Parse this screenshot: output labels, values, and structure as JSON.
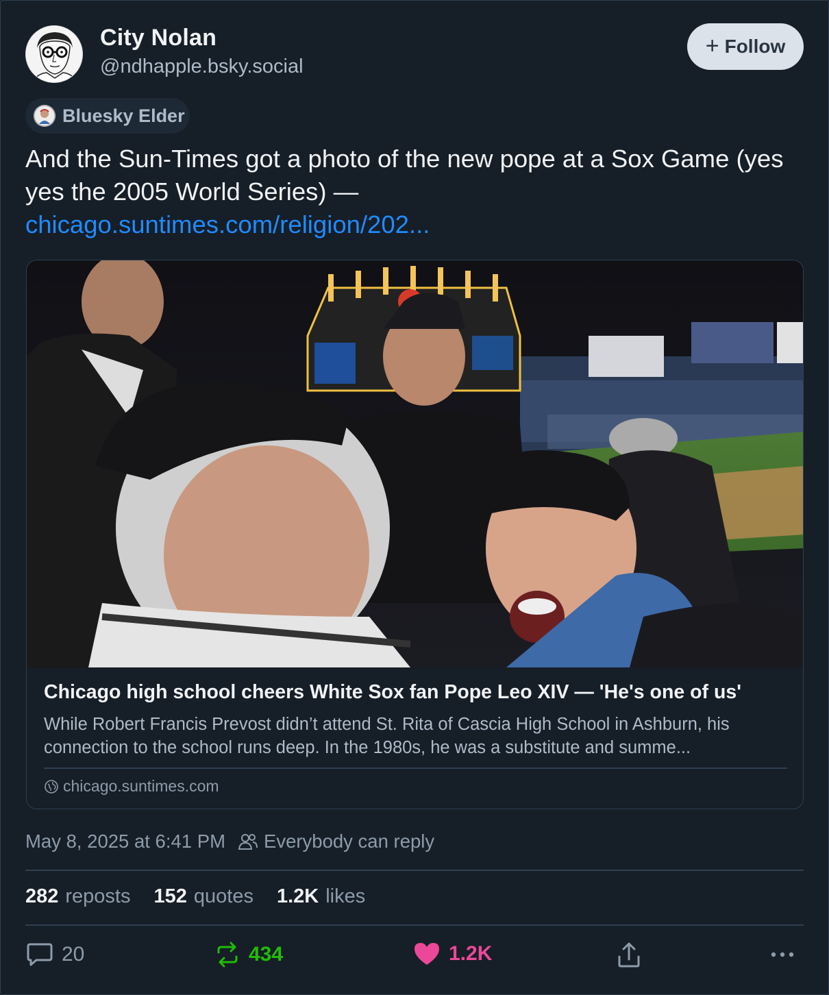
{
  "author": {
    "display_name": "City Nolan",
    "handle": "@ndhapple.bsky.social",
    "follow_label": "Follow"
  },
  "badge": {
    "label": "Bluesky Elder"
  },
  "post": {
    "text": "And the Sun-Times got a photo of the new pope at a Sox Game (yes yes the 2005 World Series) —",
    "link_text": "chicago.suntimes.com/religion/202...",
    "timestamp": "May 8, 2025 at 6:41 PM",
    "reply_setting": "Everybody can reply"
  },
  "card": {
    "title": "Chicago high school cheers White Sox fan Pope Leo XIV — 'He's one of us'",
    "description": "While Robert Francis Prevost didn’t attend St. Rita of Cascia High School in Ashburn, his connection to the school runs deep. In the 1980s, he was a substitute and summe...",
    "domain": "chicago.suntimes.com"
  },
  "stats": {
    "reposts_count": "282",
    "reposts_label": "reposts",
    "quotes_count": "152",
    "quotes_label": "quotes",
    "likes_count": "1.2K",
    "likes_label": "likes"
  },
  "actions": {
    "reply_count": "20",
    "repost_count": "434",
    "like_count": "1.2K"
  },
  "colors": {
    "background": "#161e27",
    "link": "#208bfe",
    "repost_active": "#20bc07",
    "like_active": "#ec4899",
    "muted_text": "#8d9cab"
  }
}
